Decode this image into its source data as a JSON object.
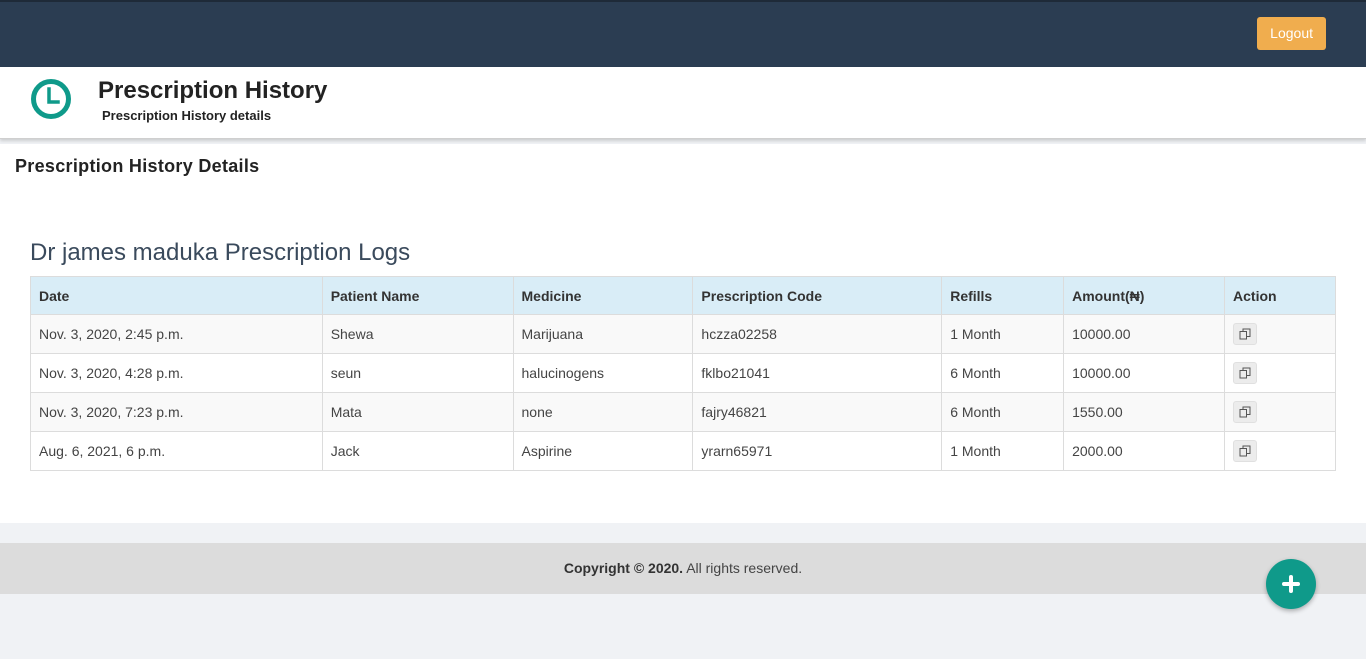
{
  "topbar": {
    "logout_label": "Logout"
  },
  "header": {
    "title": "Prescription History",
    "subtitle": "Prescription History details",
    "icon": "clock-icon",
    "accent_color": "#0f9a8a"
  },
  "section": {
    "title": "Prescription History Details"
  },
  "logs": {
    "title": "Dr james maduka Prescription Logs",
    "columns": [
      "Date",
      "Patient Name",
      "Medicine",
      "Prescription Code",
      "Refills",
      "Amount(₦)",
      "Action"
    ],
    "rows": [
      {
        "date": "Nov. 3, 2020, 2:45 p.m.",
        "patient": "Shewa",
        "medicine": "Marijuana",
        "code": "hczza02258",
        "refills": "1 Month",
        "amount": "10000.00",
        "action_icon": "copy-icon"
      },
      {
        "date": "Nov. 3, 2020, 4:28 p.m.",
        "patient": "seun",
        "medicine": "halucinogens",
        "code": "fklbo21041",
        "refills": "6 Month",
        "amount": "10000.00",
        "action_icon": "copy-icon"
      },
      {
        "date": "Nov. 3, 2020, 7:23 p.m.",
        "patient": "Mata",
        "medicine": "none",
        "code": "fajry46821",
        "refills": "6 Month",
        "amount": "1550.00",
        "action_icon": "copy-icon"
      },
      {
        "date": "Aug. 6, 2021, 6 p.m.",
        "patient": "Jack",
        "medicine": "Aspirine",
        "code": "yrarn65971",
        "refills": "1 Month",
        "amount": "2000.00",
        "action_icon": "copy-icon"
      }
    ]
  },
  "footer": {
    "copyright_bold": "Copyright © 2020.",
    "copyright_rest": " All rights reserved."
  },
  "fab": {
    "icon": "plus-icon"
  },
  "colors": {
    "topbar": "#2b3d52",
    "logout_button": "#f0ad4e",
    "table_header": "#d9edf7",
    "fab": "#0f9a8a"
  }
}
